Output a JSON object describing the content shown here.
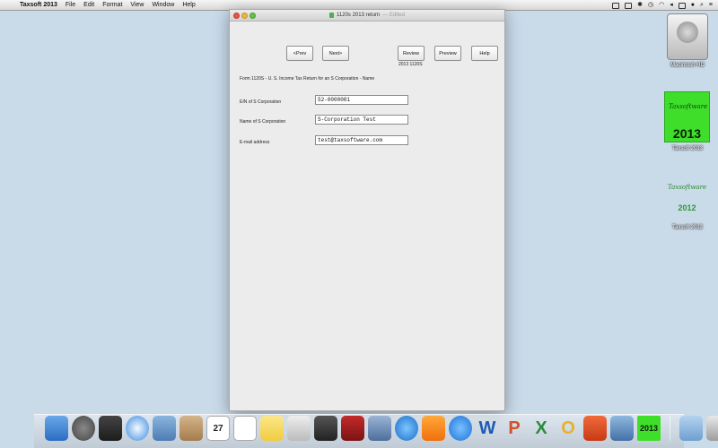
{
  "menubar": {
    "apple": "",
    "items": [
      "Taxsoft 2013",
      "File",
      "Edit",
      "Format",
      "View",
      "Window",
      "Help"
    ]
  },
  "window": {
    "title": "1120s 2013 return",
    "edited": "— Edited",
    "buttons": {
      "prev": "<Prev",
      "next": "Next>",
      "review": "Review",
      "preview": "Preview",
      "help": "Help"
    },
    "review_sublabel": "2013 1120S",
    "form_title": "Form 1120S - U. S. Income Tax Return for an S Corporation - Name",
    "fields": {
      "ein_label": "EIN of S Corporation",
      "ein_value": "52-0000001",
      "name_label": "Name of S Corporation",
      "name_value": "S-Corporation Test",
      "email_label": "E-mail address",
      "email_value": "test@taxsoftware.com"
    }
  },
  "desktop": {
    "hd_label": "Macintosh HD",
    "tax13_brand": "Taxsoftware",
    "tax13_year": "2013",
    "tax13_label": "Taxsoft 2013",
    "tax12_brand": "Taxsoftware",
    "tax12_year": "2012",
    "tax12_label": "Taxsoft 2012"
  },
  "dock": {
    "calendar_day": "27",
    "word": "W",
    "ppt": "P",
    "excel": "X",
    "outlook": "O",
    "taxsoft_year": "2013"
  }
}
